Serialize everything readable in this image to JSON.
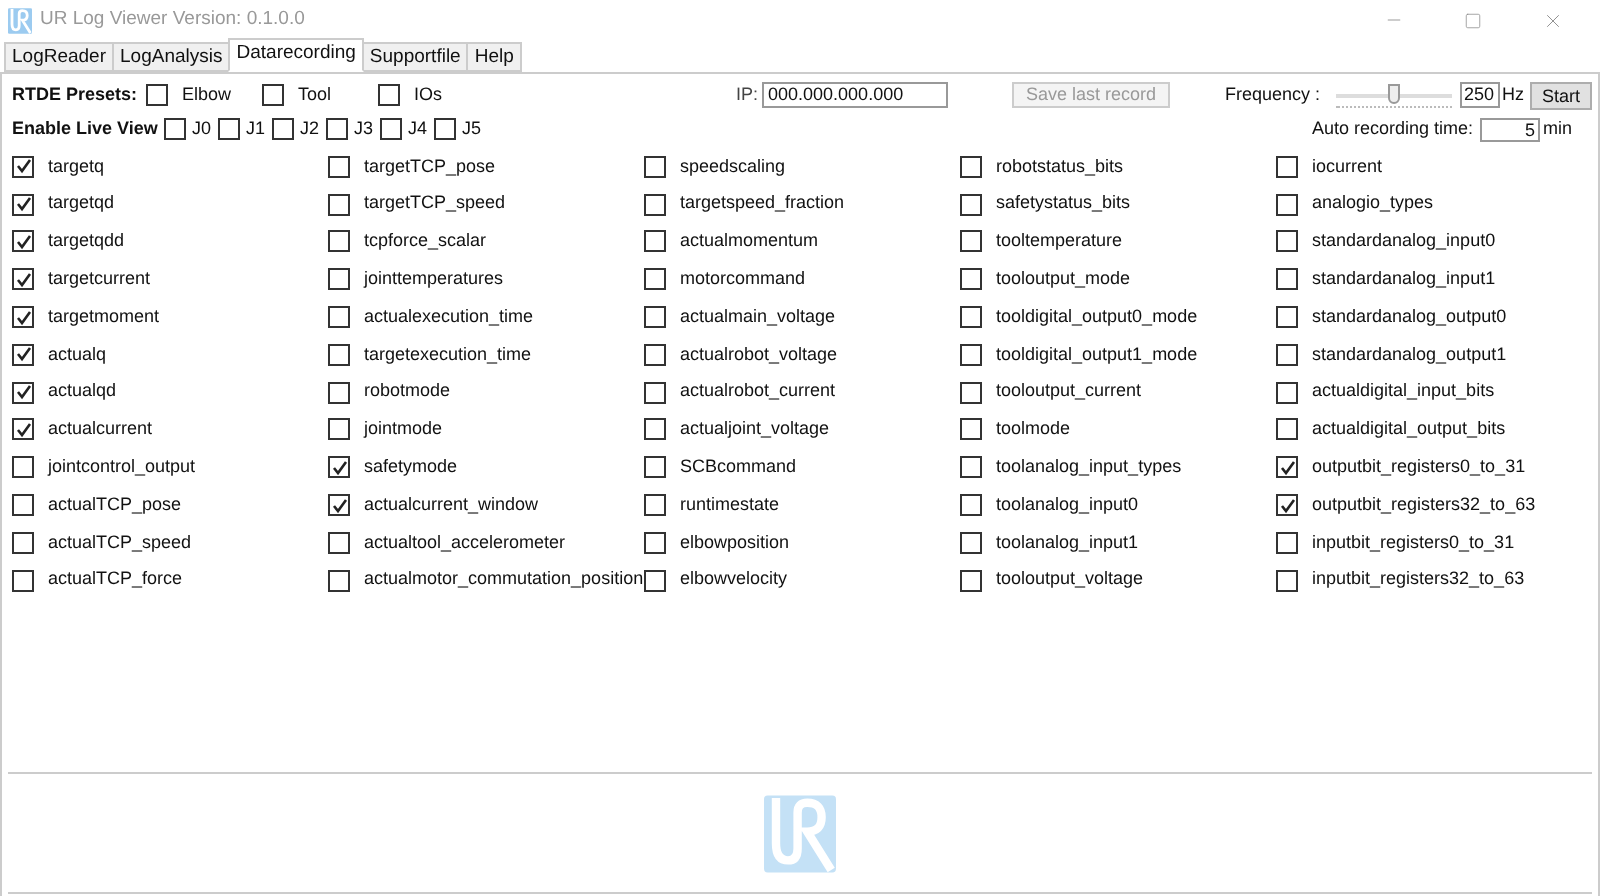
{
  "window": {
    "title": "UR Log Viewer Version: 0.1.0.0"
  },
  "tabs": [
    {
      "label": "LogReader",
      "selected": false
    },
    {
      "label": "LogAnalysis",
      "selected": false
    },
    {
      "label": "Datarecording",
      "selected": true
    },
    {
      "label": "Supportfile",
      "selected": false
    },
    {
      "label": "Help",
      "selected": false
    }
  ],
  "presets": {
    "label": "RTDE Presets:",
    "items": [
      {
        "label": "Elbow",
        "checked": false
      },
      {
        "label": "Tool",
        "checked": false
      },
      {
        "label": "IOs",
        "checked": false
      }
    ]
  },
  "ip": {
    "label": "IP:",
    "value": "000.000.000.000"
  },
  "save_button": {
    "label": "Save last record",
    "disabled": true
  },
  "frequency": {
    "label": "Frequency :",
    "level": 0.5,
    "value": "250",
    "unit": "Hz"
  },
  "start_button": "Start",
  "live_view": {
    "label": "Enable Live View",
    "items": [
      {
        "label": "J0",
        "checked": false
      },
      {
        "label": "J1",
        "checked": false
      },
      {
        "label": "J2",
        "checked": false
      },
      {
        "label": "J3",
        "checked": false
      },
      {
        "label": "J4",
        "checked": false
      },
      {
        "label": "J5",
        "checked": false
      }
    ]
  },
  "auto_recording": {
    "label": "Auto recording time:",
    "value": "5",
    "unit": "min"
  },
  "columns": [
    [
      {
        "label": "targetq",
        "checked": true
      },
      {
        "label": "targetqd",
        "checked": true
      },
      {
        "label": "targetqdd",
        "checked": true
      },
      {
        "label": "targetcurrent",
        "checked": true
      },
      {
        "label": "targetmoment",
        "checked": true
      },
      {
        "label": "actualq",
        "checked": true
      },
      {
        "label": "actualqd",
        "checked": true
      },
      {
        "label": "actualcurrent",
        "checked": true
      },
      {
        "label": "jointcontrol_output",
        "checked": false
      },
      {
        "label": "actualTCP_pose",
        "checked": false
      },
      {
        "label": "actualTCP_speed",
        "checked": false
      },
      {
        "label": "actualTCP_force",
        "checked": false
      }
    ],
    [
      {
        "label": "targetTCP_pose",
        "checked": false
      },
      {
        "label": "targetTCP_speed",
        "checked": false
      },
      {
        "label": "tcpforce_scalar",
        "checked": false
      },
      {
        "label": "jointtemperatures",
        "checked": false
      },
      {
        "label": "actualexecution_time",
        "checked": false
      },
      {
        "label": "targetexecution_time",
        "checked": false
      },
      {
        "label": "robotmode",
        "checked": false
      },
      {
        "label": "jointmode",
        "checked": false
      },
      {
        "label": "safetymode",
        "checked": true
      },
      {
        "label": "actualcurrent_window",
        "checked": true
      },
      {
        "label": "actualtool_accelerometer",
        "checked": false
      },
      {
        "label": "actualmotor_commutation_position",
        "checked": false
      }
    ],
    [
      {
        "label": "speedscaling",
        "checked": false
      },
      {
        "label": "targetspeed_fraction",
        "checked": false
      },
      {
        "label": "actualmomentum",
        "checked": false
      },
      {
        "label": "motorcommand",
        "checked": false
      },
      {
        "label": "actualmain_voltage",
        "checked": false
      },
      {
        "label": "actualrobot_voltage",
        "checked": false
      },
      {
        "label": "actualrobot_current",
        "checked": false
      },
      {
        "label": "actualjoint_voltage",
        "checked": false
      },
      {
        "label": "SCBcommand",
        "checked": false
      },
      {
        "label": "runtimestate",
        "checked": false
      },
      {
        "label": "elbowposition",
        "checked": false
      },
      {
        "label": "elbowvelocity",
        "checked": false
      }
    ],
    [
      {
        "label": "robotstatus_bits",
        "checked": false
      },
      {
        "label": "safetystatus_bits",
        "checked": false
      },
      {
        "label": "tooltemperature",
        "checked": false
      },
      {
        "label": "tooloutput_mode",
        "checked": false
      },
      {
        "label": "tooldigital_output0_mode",
        "checked": false
      },
      {
        "label": "tooldigital_output1_mode",
        "checked": false
      },
      {
        "label": "tooloutput_current",
        "checked": false
      },
      {
        "label": "toolmode",
        "checked": false
      },
      {
        "label": "toolanalog_input_types",
        "checked": false
      },
      {
        "label": "toolanalog_input0",
        "checked": false
      },
      {
        "label": "toolanalog_input1",
        "checked": false
      },
      {
        "label": "tooloutput_voltage",
        "checked": false
      }
    ],
    [
      {
        "label": "iocurrent",
        "checked": false
      },
      {
        "label": "analogio_types",
        "checked": false
      },
      {
        "label": "standardanalog_input0",
        "checked": false
      },
      {
        "label": "standardanalog_input1",
        "checked": false
      },
      {
        "label": "standardanalog_output0",
        "checked": false
      },
      {
        "label": "standardanalog_output1",
        "checked": false
      },
      {
        "label": "actualdigital_input_bits",
        "checked": false
      },
      {
        "label": "actualdigital_output_bits",
        "checked": false
      },
      {
        "label": "outputbit_registers0_to_31",
        "checked": true
      },
      {
        "label": "outputbit_registers32_to_63",
        "checked": true
      },
      {
        "label": "inputbit_registers0_to_31",
        "checked": false
      },
      {
        "label": "inputbit_registers32_to_63",
        "checked": false
      }
    ]
  ]
}
